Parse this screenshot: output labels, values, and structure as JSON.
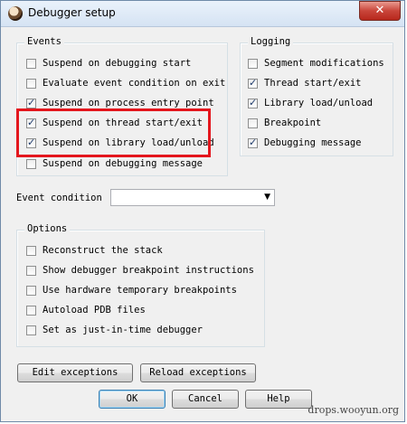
{
  "window": {
    "title": "Debugger setup",
    "close_glyph": "✕"
  },
  "events": {
    "legend": "Events",
    "items": [
      {
        "label": "Suspend on debugging start",
        "checked": false
      },
      {
        "label": "Evaluate event condition on exit",
        "checked": false
      },
      {
        "label": "Suspend on process entry point",
        "checked": true
      },
      {
        "label": "Suspend on thread start/exit",
        "checked": true
      },
      {
        "label": "Suspend on library load/unload",
        "checked": true
      },
      {
        "label": "Suspend on debugging message",
        "checked": false
      }
    ]
  },
  "logging": {
    "legend": "Logging",
    "items": [
      {
        "label": "Segment modifications",
        "checked": false
      },
      {
        "label": "Thread start/exit",
        "checked": true
      },
      {
        "label": "Library load/unload",
        "checked": true
      },
      {
        "label": "Breakpoint",
        "checked": false
      },
      {
        "label": "Debugging message",
        "checked": true
      }
    ]
  },
  "event_condition": {
    "label": "Event condition",
    "value": "",
    "arrow": "▼"
  },
  "options": {
    "legend": "Options",
    "items": [
      {
        "label": "Reconstruct the stack",
        "checked": false
      },
      {
        "label": "Show debugger breakpoint instructions",
        "checked": false
      },
      {
        "label": "Use hardware temporary breakpoints",
        "checked": false
      },
      {
        "label": "Autoload PDB files",
        "checked": false
      },
      {
        "label": "Set as just-in-time debugger",
        "checked": false
      }
    ]
  },
  "buttons": {
    "edit_exceptions": "Edit exceptions",
    "reload_exceptions": "Reload exceptions",
    "ok": "OK",
    "cancel": "Cancel",
    "help": "Help"
  },
  "watermark": "drops.wooyun.org",
  "colors": {
    "highlight": "#e4161d",
    "titlebar": "#d5e3f3",
    "close": "#c9453a"
  }
}
